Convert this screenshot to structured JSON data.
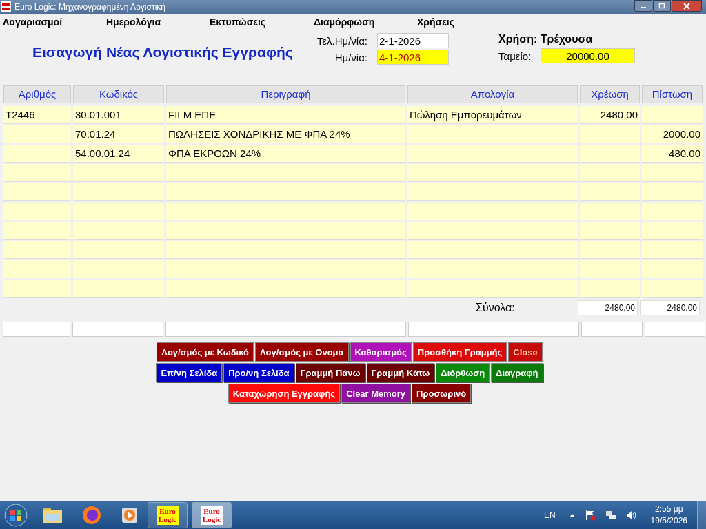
{
  "window": {
    "title": "Euro Logic: Μηχανογραφημένη Λογιστική"
  },
  "menu": [
    "Λογαριασμοί",
    "Ημερολόγια",
    "Εκτυπώσεις",
    "Διαμόρφωση",
    "Χρήσεις"
  ],
  "form": {
    "heading": "Εισαγωγή Νέας Λογιστικής Εγγραφής",
    "last_date_label": "Τελ.Ημ/νία:",
    "last_date": "2-1-2026",
    "date_label": "Ημ/νία:",
    "date": "4-1-2026",
    "period": "Χρήση: Τρέχουσα",
    "cash_label": "Ταμείο:",
    "cash": "20000.00"
  },
  "table": {
    "columns": [
      "Αριθμός",
      "Κωδικός",
      "Περιγραφή",
      "Απολογία",
      "Χρέωση",
      "Πίστωση"
    ],
    "rows": [
      {
        "number": "T2446",
        "code": "30.01.001",
        "description": "FILM ΕΠΕ",
        "note": "Πώληση Εμπορευμάτων",
        "debit": "2480.00"
      },
      {
        "code": "70.01.24",
        "description": "ΠΩΛΗΣΕΙΣ ΧΟΝΔΡΙΚΗΣ ΜΕ ΦΠΑ 24%",
        "credit": "2000.00"
      },
      {
        "code": "54.00.01.24",
        "description": "ΦΠΑ ΕΚΡΟΩΝ 24%",
        "credit": "480.00"
      }
    ],
    "totals_label": "Σύνολα:",
    "total_debit": "2480.00",
    "total_credit": "2480.00"
  },
  "button_rows": [
    [
      {
        "label": "Λογ/σμός με Κωδικό",
        "color": "#990000",
        "disabled": false
      },
      {
        "label": "Λογ/σμός με Ονομα",
        "color": "#990000",
        "disabled": false
      },
      {
        "label": "Καθαρισμός",
        "color": "#b012b8",
        "disabled": false
      },
      {
        "label": "Προσθήκη Γραμμής",
        "color": "#dd0a0a",
        "disabled": false
      },
      {
        "label": "Close",
        "color": "#c80a0a",
        "disabled": true
      }
    ],
    [
      {
        "label": "Επ/νη Σελίδα",
        "color": "#0000c8",
        "disabled": false
      },
      {
        "label": "Προ/νη Σελίδα",
        "color": "#0000c8",
        "disabled": false
      },
      {
        "label": "Γραμμή Πάνω",
        "color": "#6a0000",
        "disabled": false
      },
      {
        "label": "Γραμμή Κάτω",
        "color": "#6a0000",
        "disabled": false
      },
      {
        "label": "Διόρθωση",
        "color": "#0a8a0a",
        "disabled": false
      },
      {
        "label": "Διαγραφή",
        "color": "#0a7a0a",
        "disabled": false
      }
    ],
    [
      {
        "label": "Καταχώρηση Εγγραφής",
        "color": "#ff0a0a",
        "disabled": false
      },
      {
        "label": "Clear Memory",
        "color": "#9010a0",
        "disabled": false
      },
      {
        "label": "Προσωρινό",
        "color": "#880000",
        "disabled": false
      }
    ]
  ],
  "taskbar": {
    "apps": [
      {
        "kind": "folder"
      },
      {
        "kind": "firefox"
      },
      {
        "kind": "media"
      },
      {
        "kind": "eurologic",
        "label_top": "Euro",
        "label_bottom": "Logic",
        "selected": false
      },
      {
        "kind": "eurologic",
        "label_top": "Euro",
        "label_bottom": "Logic",
        "selected": true
      }
    ],
    "language": "EN",
    "time": "2:55 μμ",
    "date": "19/5/2026"
  }
}
